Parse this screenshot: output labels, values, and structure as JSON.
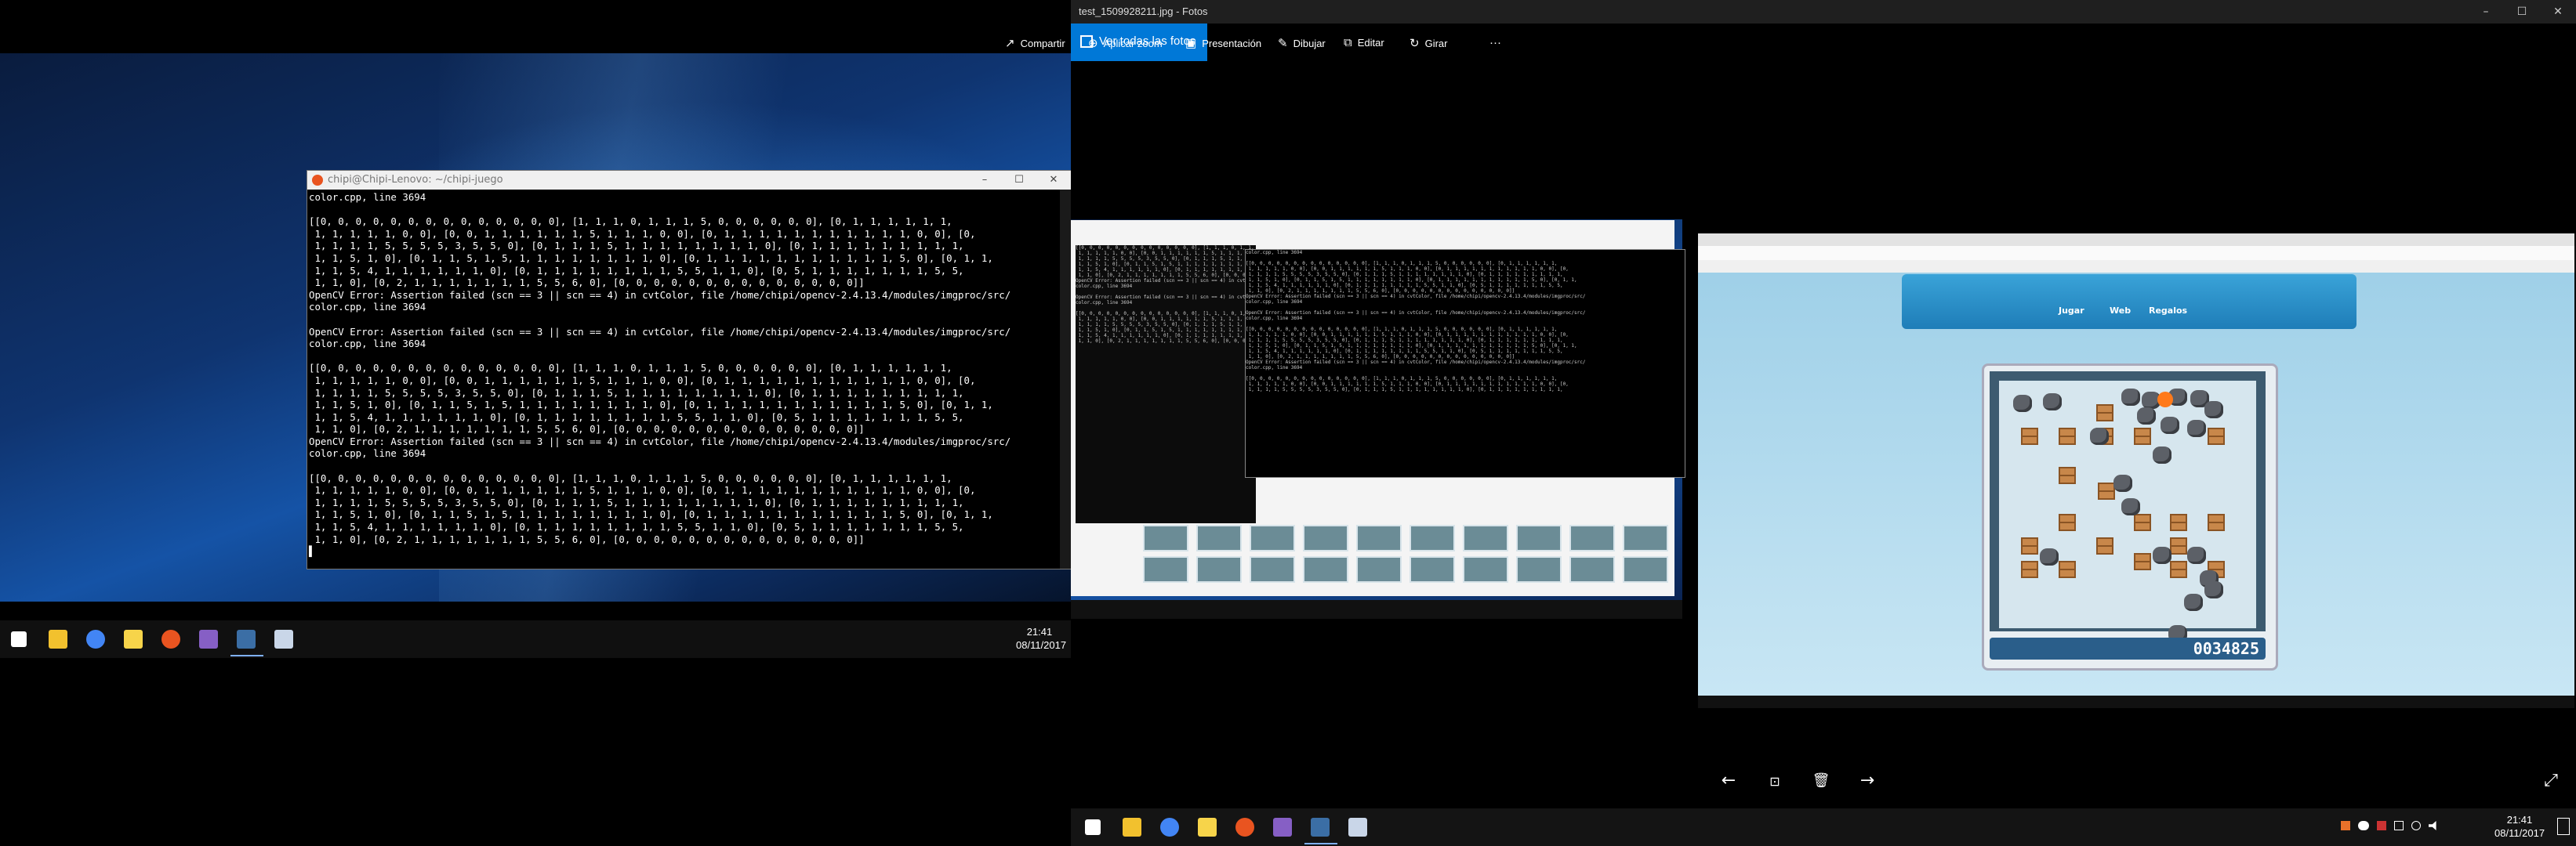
{
  "left_screen": {
    "terminal": {
      "title": "chipi@Chipi-Lenovo: ~/chipi-juego",
      "controls": [
        "–",
        "☐",
        "✕"
      ],
      "lines": [
        "color.cpp, line 3694",
        "",
        "[[0, 0, 0, 0, 0, 0, 0, 0, 0, 0, 0, 0, 0, 0], [1, 1, 1, 0, 1, 1, 1, 5, 0, 0, 0, 0, 0, 0], [0, 1, 1, 1, 1, 1, 1,",
        " 1, 1, 1, 1, 1, 0, 0], [0, 0, 1, 1, 1, 1, 1, 1, 5, 1, 1, 1, 0, 0], [0, 1, 1, 1, 1, 1, 1, 1, 1, 1, 1, 1, 0, 0], [0,",
        " 1, 1, 1, 1, 5, 5, 5, 5, 3, 5, 5, 0], [0, 1, 1, 1, 5, 1, 1, 1, 1, 1, 1, 1, 1, 0], [0, 1, 1, 1, 1, 1, 1, 1, 1, 1,",
        " 1, 1, 5, 1, 0], [0, 1, 1, 5, 1, 5, 1, 1, 1, 1, 1, 1, 1, 1, 0], [0, 1, 1, 1, 1, 1, 1, 1, 1, 1, 1, 1, 5, 0], [0, 1, 1,",
        " 1, 1, 5, 4, 1, 1, 1, 1, 1, 1, 0], [0, 1, 1, 1, 1, 1, 1, 1, 1, 5, 5, 1, 1, 0], [0, 5, 1, 1, 1, 1, 1, 1, 1, 5, 5,",
        " 1, 1, 0], [0, 2, 1, 1, 1, 1, 1, 1, 1, 5, 5, 6, 0], [0, 0, 0, 0, 0, 0, 0, 0, 0, 0, 0, 0, 0, 0]]",
        "OpenCV Error: Assertion failed (scn == 3 || scn == 4) in cvtColor, file /home/chipi/opencv-2.4.13.4/modules/imgproc/src/",
        "color.cpp, line 3694",
        "",
        "OpenCV Error: Assertion failed (scn == 3 || scn == 4) in cvtColor, file /home/chipi/opencv-2.4.13.4/modules/imgproc/src/",
        "color.cpp, line 3694",
        "",
        "[[0, 0, 0, 0, 0, 0, 0, 0, 0, 0, 0, 0, 0, 0], [1, 1, 1, 0, 1, 1, 1, 5, 0, 0, 0, 0, 0, 0], [0, 1, 1, 1, 1, 1, 1,",
        " 1, 1, 1, 1, 1, 0, 0], [0, 0, 1, 1, 1, 1, 1, 1, 5, 1, 1, 1, 0, 0], [0, 1, 1, 1, 1, 1, 1, 1, 1, 1, 1, 1, 0, 0], [0,",
        " 1, 1, 1, 1, 5, 5, 5, 5, 3, 5, 5, 0], [0, 1, 1, 1, 5, 1, 1, 1, 1, 1, 1, 1, 1, 0], [0, 1, 1, 1, 1, 1, 1, 1, 1, 1,",
        " 1, 1, 5, 1, 0], [0, 1, 1, 5, 1, 5, 1, 1, 1, 1, 1, 1, 1, 1, 0], [0, 1, 1, 1, 1, 1, 1, 1, 1, 1, 1, 1, 5, 0], [0, 1, 1,",
        " 1, 1, 5, 4, 1, 1, 1, 1, 1, 1, 0], [0, 1, 1, 1, 1, 1, 1, 1, 1, 5, 5, 1, 1, 0], [0, 5, 1, 1, 1, 1, 1, 1, 1, 5, 5,",
        " 1, 1, 0], [0, 2, 1, 1, 1, 1, 1, 1, 1, 5, 5, 6, 0], [0, 0, 0, 0, 0, 0, 0, 0, 0, 0, 0, 0, 0, 0]]",
        "OpenCV Error: Assertion failed (scn == 3 || scn == 4) in cvtColor, file /home/chipi/opencv-2.4.13.4/modules/imgproc/src/",
        "color.cpp, line 3694",
        "",
        "[[0, 0, 0, 0, 0, 0, 0, 0, 0, 0, 0, 0, 0, 0], [1, 1, 1, 0, 1, 1, 1, 5, 0, 0, 0, 0, 0, 0], [0, 1, 1, 1, 1, 1, 1,",
        " 1, 1, 1, 1, 1, 0, 0], [0, 0, 1, 1, 1, 1, 1, 1, 5, 1, 1, 1, 0, 0], [0, 1, 1, 1, 1, 1, 1, 1, 1, 1, 1, 1, 0, 0], [0,",
        " 1, 1, 1, 1, 5, 5, 5, 5, 3, 5, 5, 0], [0, 1, 1, 1, 5, 1, 1, 1, 1, 1, 1, 1, 1, 0], [0, 1, 1, 1, 1, 1, 1, 1, 1, 1,",
        " 1, 1, 5, 1, 0], [0, 1, 1, 5, 1, 5, 1, 1, 1, 1, 1, 1, 1, 1, 0], [0, 1, 1, 1, 1, 1, 1, 1, 1, 1, 1, 1, 5, 0], [0, 1, 1,",
        " 1, 1, 5, 4, 1, 1, 1, 1, 1, 1, 0], [0, 1, 1, 1, 1, 1, 1, 1, 1, 5, 5, 1, 1, 0], [0, 5, 1, 1, 1, 1, 1, 1, 1, 5, 5,",
        " 1, 1, 0], [0, 2, 1, 1, 1, 1, 1, 1, 1, 5, 5, 6, 0], [0, 0, 0, 0, 0, 0, 0, 0, 0, 0, 0, 0, 0, 0]]",
        "▌"
      ]
    },
    "taskbar": {
      "icons": [
        "windows-start-icon",
        "file-explorer-icon",
        "chrome-icon",
        "sticky-notes-icon",
        "ubuntu-icon",
        "visual-studio-icon",
        "photos-icon",
        "terminal-icon"
      ],
      "time": "21:41",
      "date": "08/11/2017"
    }
  },
  "photos_app": {
    "title": "test_1509928211.jpg - Fotos",
    "window_controls": [
      "–",
      "☐",
      "✕"
    ],
    "back_button": "Ver todas las fotos",
    "toolbar": [
      {
        "icon": "share-icon",
        "glyph": "↗",
        "label": "Compartir"
      },
      {
        "icon": "zoom-icon",
        "glyph": "⊕",
        "label": "Aplicar zoom"
      },
      {
        "icon": "slideshow-icon",
        "glyph": "▣",
        "label": "Presentación"
      },
      {
        "icon": "draw-icon",
        "glyph": "✎",
        "label": "Dibujar"
      },
      {
        "icon": "edit-icon",
        "glyph": "⧉",
        "label": "Editar"
      },
      {
        "icon": "rotate-icon",
        "glyph": "↻",
        "label": "Girar"
      },
      {
        "icon": "more-icon",
        "glyph": "···",
        "label": ""
      }
    ],
    "nav": {
      "prev": "←",
      "info": "⊡",
      "delete": "🗑",
      "next": "→",
      "fullscreen": "⤢"
    },
    "game": {
      "score": "0034825",
      "menu_tabs": [
        "Jugar",
        "Web",
        "Regalos"
      ]
    },
    "taskbar": {
      "time": "21:41",
      "date": "08/11/2017"
    }
  },
  "colors": {
    "accent": "#0078d7",
    "terminal_bg": "#000000",
    "ubuntu": "#e95420"
  }
}
